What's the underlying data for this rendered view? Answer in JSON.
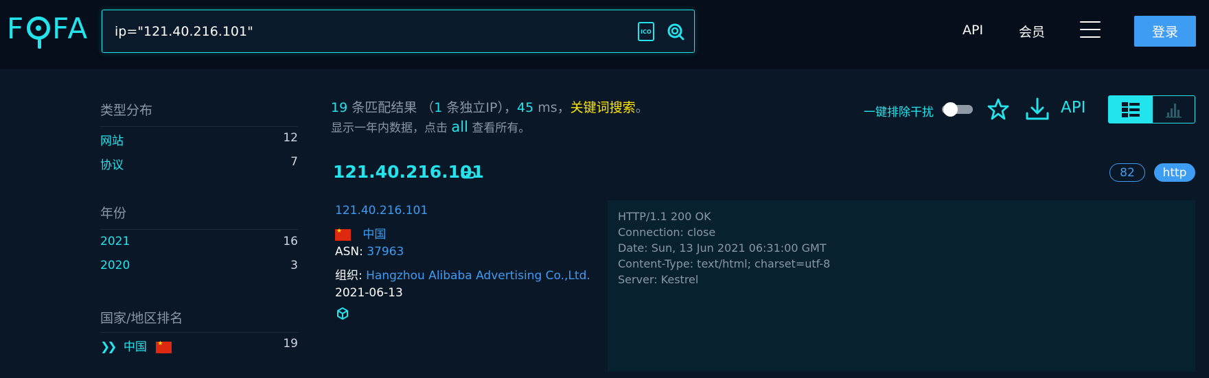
{
  "header": {
    "logo_text": "FOFA",
    "search": {
      "value": "ip=\"121.40.216.101\"",
      "placeholder": ""
    },
    "ico_label": "ICO",
    "nav": {
      "api": "API",
      "vip": "会员"
    },
    "login": "登录"
  },
  "sidebar": {
    "type": {
      "title": "类型分布",
      "items": [
        {
          "label": "网站",
          "count": "12"
        },
        {
          "label": "协议",
          "count": "7"
        }
      ]
    },
    "year": {
      "title": "年份",
      "items": [
        {
          "label": "2021",
          "count": "16"
        },
        {
          "label": "2020",
          "count": "3"
        }
      ]
    },
    "country": {
      "title": "国家/地区排名",
      "items": [
        {
          "label": "中国",
          "count": "19"
        }
      ]
    }
  },
  "summary": {
    "count": "19",
    "count_text": " 条匹配结果 （",
    "unique_ip": "1",
    "unique_text": " 条独立IP），",
    "ms": "45",
    "ms_text": " ms，",
    "keyword": "关键词搜索",
    "end": "。",
    "line2_pre": "显示一年内数据，点击 ",
    "line2_all": "all",
    "line2_post": " 查看所有。"
  },
  "tools": {
    "exclude_label": "一键排除干扰",
    "exclude_enabled": false,
    "api": "API"
  },
  "result": {
    "ip": "121.40.216.101",
    "port": "82",
    "protocol": "http",
    "host": "121.40.216.101",
    "country": "中国",
    "asn_label": "ASN: ",
    "asn": "37963",
    "org_label": "组织: ",
    "org": "Hangzhou Alibaba Advertising Co.,Ltd.",
    "date": "2021-06-13",
    "banner": [
      "HTTP/1.1 200 OK",
      "Connection: close",
      "Date: Sun, 13 Jun 2021 06:31:00 GMT",
      "Content-Type: text/html; charset=utf-8",
      "Server: Kestrel"
    ]
  },
  "colors": {
    "accent": "#23e4ec",
    "link": "#3e9cf2",
    "highlight": "#ffe600",
    "background": "#0a1726",
    "header_bg": "#050e1a"
  }
}
